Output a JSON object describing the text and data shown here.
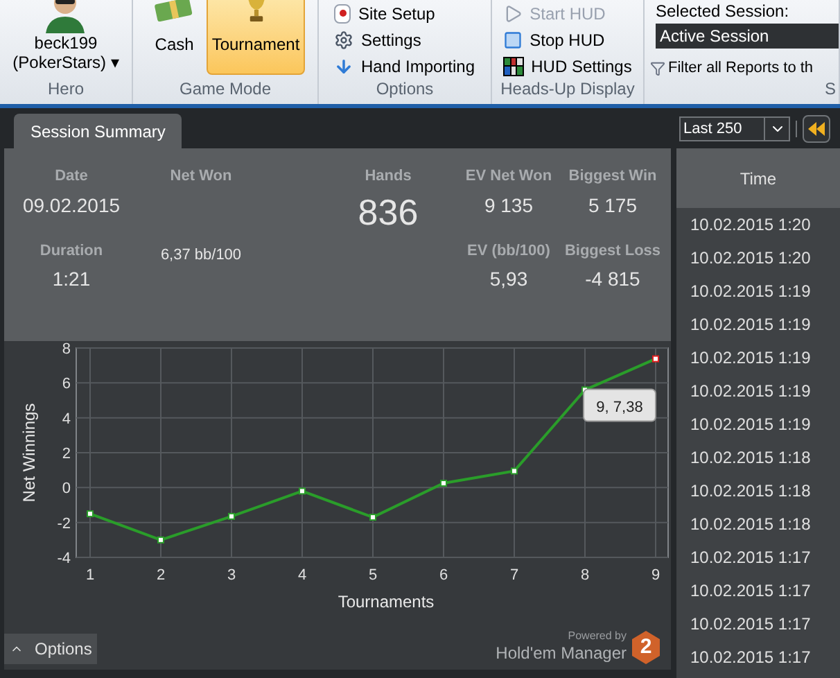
{
  "ribbon": {
    "groups": [
      {
        "label": "Hero",
        "kind": "hero",
        "items": [
          {
            "label": "beck199\n(PokerStars)",
            "caret": "▾"
          }
        ]
      },
      {
        "label": "Game Mode",
        "kind": "large",
        "items": [
          {
            "label": "Cash",
            "selected": false
          },
          {
            "label": "Tournament",
            "selected": true
          }
        ]
      },
      {
        "label": "Options",
        "kind": "small",
        "items": [
          {
            "label": "Site Setup",
            "disabled": false
          },
          {
            "label": "Settings",
            "disabled": false
          },
          {
            "label": "Hand Importing",
            "disabled": false
          }
        ]
      },
      {
        "label": "Heads-Up Display",
        "kind": "small",
        "items": [
          {
            "label": "Start HUD",
            "disabled": true
          },
          {
            "label": "Stop HUD",
            "disabled": false
          },
          {
            "label": "HUD Settings",
            "disabled": false
          }
        ]
      },
      {
        "label": "S",
        "kind": "session",
        "items": [
          {
            "label": "Selected Session:"
          },
          {
            "label": "Active Session"
          },
          {
            "label": "Filter all Reports to th"
          }
        ]
      }
    ]
  },
  "tabs": [
    {
      "label": "Session Summary",
      "selected": true
    }
  ],
  "summary": {
    "date": {
      "label": "Date",
      "value": "09.02.2015"
    },
    "net_won": {
      "label": "Net Won",
      "value": "6,37 bb/100"
    },
    "hands": {
      "label": "Hands",
      "value": "836"
    },
    "ev_net_won": {
      "label": "EV Net Won",
      "value": "9 135"
    },
    "biggest_win": {
      "label": "Biggest Win",
      "value": "5 175"
    },
    "duration": {
      "label": "Duration",
      "value": "1:21"
    },
    "ev_bb_100": {
      "label": "EV (bb/100)",
      "value": "5,93"
    },
    "biggest_loss": {
      "label": "Biggest Loss",
      "value": "-4 815"
    }
  },
  "chart": {
    "chart_data": {
      "type": "line",
      "xlabel": "Tournaments",
      "ylabel": "Net Winnings",
      "x": [
        1,
        2,
        3,
        4,
        5,
        6,
        7,
        8,
        9
      ],
      "grid": true,
      "series": [
        {
          "color": "#2a9d2a",
          "marker": true,
          "values": [
            -1.5,
            -3,
            -1.65,
            -0.2,
            -1.7,
            0.25,
            0.95,
            5.6,
            7.38
          ]
        }
      ],
      "xlim": [
        1,
        9
      ],
      "ylim": [
        -4,
        8
      ],
      "xticks": [
        1,
        2,
        3,
        4,
        5,
        6,
        7,
        8,
        9
      ],
      "yticks": [
        -4,
        -2,
        0,
        2,
        4,
        6,
        8
      ],
      "annotations": [
        {
          "x": 9,
          "y": 7.38,
          "text": "9, 7,38"
        }
      ]
    },
    "options_button": "Options",
    "logo": {
      "powered_by": "Powered by",
      "name": "Hold'em Manager",
      "badge": "2"
    }
  },
  "session_list": {
    "filter": "Last 250",
    "columns": [
      "Time"
    ],
    "rows": [
      "10.02.2015 1:20",
      "10.02.2015 1:20",
      "10.02.2015 1:19",
      "10.02.2015 1:19",
      "10.02.2015 1:19",
      "10.02.2015 1:19",
      "10.02.2015 1:19",
      "10.02.2015 1:18",
      "10.02.2015 1:18",
      "10.02.2015 1:18",
      "10.02.2015 1:17",
      "10.02.2015 1:17",
      "10.02.2015 1:17",
      "10.02.2015 1:17"
    ]
  }
}
